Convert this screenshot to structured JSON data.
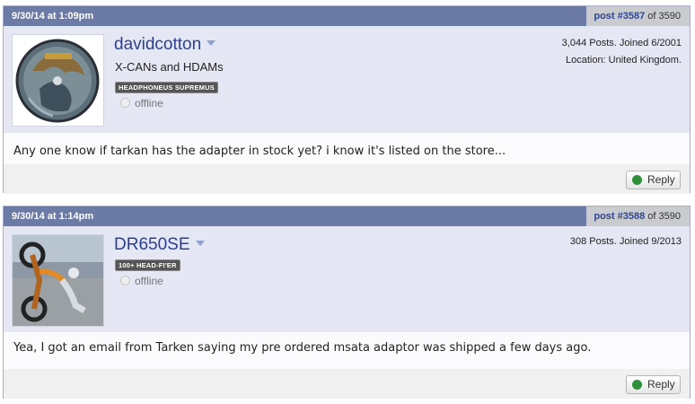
{
  "posts": [
    {
      "date": "9/30/14 at 1:09pm",
      "post_label": "post #3587",
      "post_of": "of 3590",
      "username": "davidcotton",
      "user_title": "X-CANs and HDAMs",
      "rank_badge": "HEADPHONEUS SUPREMUS",
      "status": "offline",
      "meta_line1": "3,044 Posts. Joined 6/2001",
      "meta_line2": "Location: United Kingdom.",
      "message": "Any one know if tarkan has the adapter in stock yet? i know it's listed on the store...",
      "reply_label": "Reply"
    },
    {
      "date": "9/30/14 at 1:14pm",
      "post_label": "post #3588",
      "post_of": "of 3590",
      "username": "DR650SE",
      "rank_badge": "100+ HEAD-FI'ER",
      "status": "offline",
      "meta_line1": "308 Posts. Joined 9/2013",
      "message": "Yea, I got an email from Tarken saying my pre ordered msata adaptor was shipped a few days ago.",
      "reply_label": "Reply"
    }
  ],
  "colors": {
    "header_bg": "#6c7aa6",
    "userinfo_bg": "#e5e8f4",
    "username": "#2a3f92",
    "reply_icon": "#2f8f3a"
  }
}
